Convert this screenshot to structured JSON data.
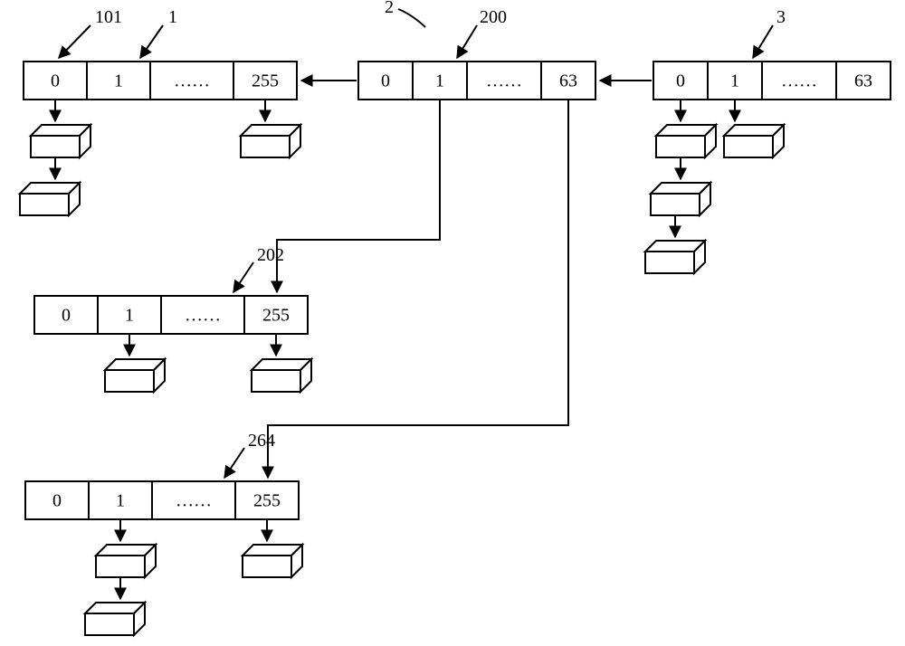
{
  "labels": {
    "l1": "1",
    "l2": "2",
    "l3": "3",
    "l101": "101",
    "l200": "200",
    "l202": "202",
    "l264": "264"
  },
  "arrays": {
    "a1": {
      "cells": [
        "0",
        "1",
        "……",
        "255"
      ]
    },
    "a2": {
      "cells": [
        "0",
        "1",
        "……",
        "63"
      ]
    },
    "a3": {
      "cells": [
        "0",
        "1",
        "……",
        "63"
      ]
    },
    "sub202": {
      "cells": [
        "0",
        "1",
        "……",
        "255"
      ]
    },
    "sub264": {
      "cells": [
        "0",
        "1",
        "……",
        "255"
      ]
    }
  }
}
